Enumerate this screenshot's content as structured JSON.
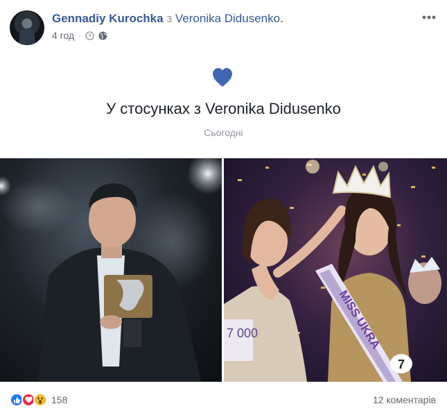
{
  "post": {
    "author": "Gennadiy Kurochka",
    "with_word": "з",
    "tagged": "Veronika Didusenko",
    "dot": ".",
    "time": "4 год",
    "separator": "·"
  },
  "life_event": {
    "title": "У стосунках з Veronika Didusenko",
    "date": "Сьогодні"
  },
  "photos": {
    "right_sash_text": "MISS UKRA",
    "right_number": "7"
  },
  "reactions": {
    "types": [
      "like-icon",
      "love-icon",
      "wow-icon"
    ],
    "count": "158"
  },
  "comments_label": "12 коментарів",
  "colors": {
    "link": "#365899",
    "heart": "#4267b2",
    "secondary_text": "#90949c"
  }
}
